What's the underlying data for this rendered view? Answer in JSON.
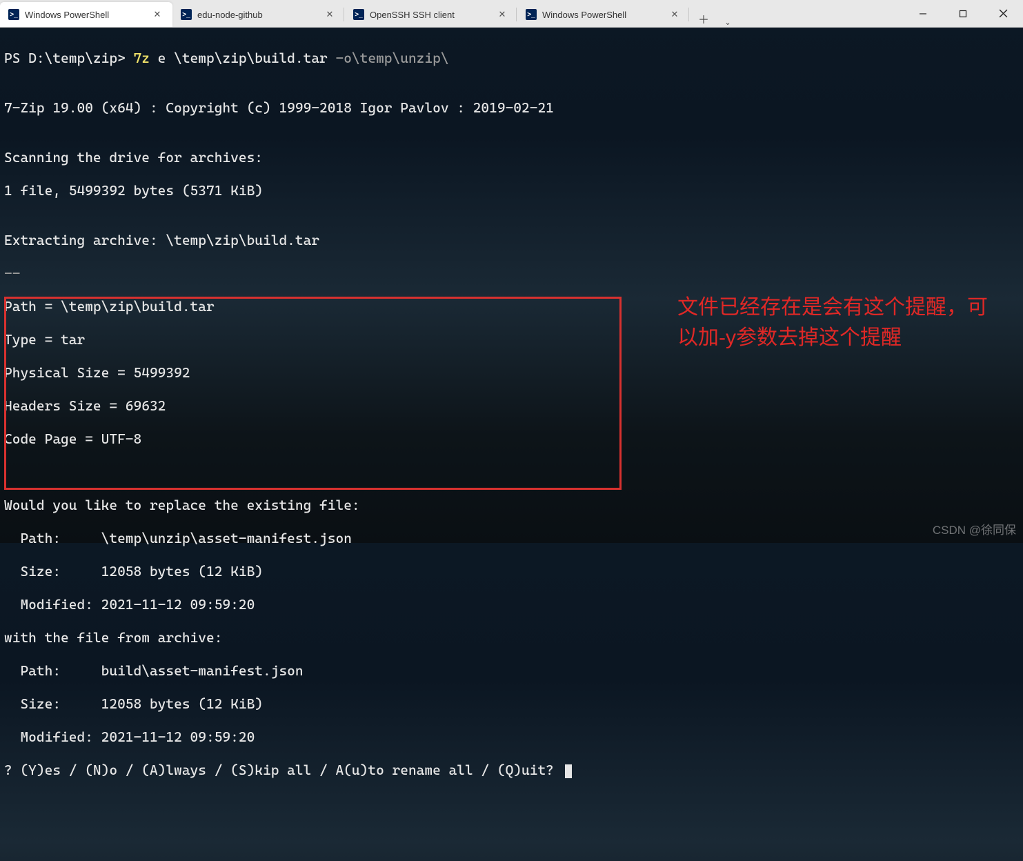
{
  "tabs": [
    {
      "label": "Windows PowerShell",
      "active": true
    },
    {
      "label": "edu-node-github",
      "active": false
    },
    {
      "label": "OpenSSH SSH client",
      "active": false
    },
    {
      "label": "Windows PowerShell",
      "active": false
    }
  ],
  "prompt": {
    "ps": "PS D:\\temp\\zip> ",
    "cmd": "7z",
    "args_white": " e \\temp\\zip\\build.tar",
    "args_grey": " -o\\temp\\unzip\\"
  },
  "output": {
    "blank1": "",
    "version": "7-Zip 19.00 (x64) : Copyright (c) 1999-2018 Igor Pavlov : 2019-02-21",
    "blank2": "",
    "scan": "Scanning the drive for archives:",
    "files": "1 file, 5499392 bytes (5371 KiB)",
    "blank3": "",
    "extract": "Extracting archive: \\temp\\zip\\build.tar",
    "sep": "--",
    "path": "Path = \\temp\\zip\\build.tar",
    "type": "Type = tar",
    "psize": "Physical Size = 5499392",
    "hsize": "Headers Size = 69632",
    "cpage": "Code Page = UTF-8",
    "blank4": "",
    "blank5": "",
    "q1": "Would you like to replace the existing file:",
    "q1_path": "  Path:     \\temp\\unzip\\asset-manifest.json",
    "q1_size": "  Size:     12058 bytes (12 KiB)",
    "q1_mod": "  Modified: 2021-11-12 09:59:20",
    "q2": "with the file from archive:",
    "q2_path": "  Path:     build\\asset-manifest.json",
    "q2_size": "  Size:     12058 bytes (12 KiB)",
    "q2_mod": "  Modified: 2021-11-12 09:59:20",
    "choice": "? (Y)es / (N)o / (A)lways / (S)kip all / A(u)to rename all / (Q)uit? "
  },
  "annotation": "文件已经存在是会有这个提醒，可以加-y参数去掉这个提醒",
  "watermark": "CSDN @徐同保"
}
